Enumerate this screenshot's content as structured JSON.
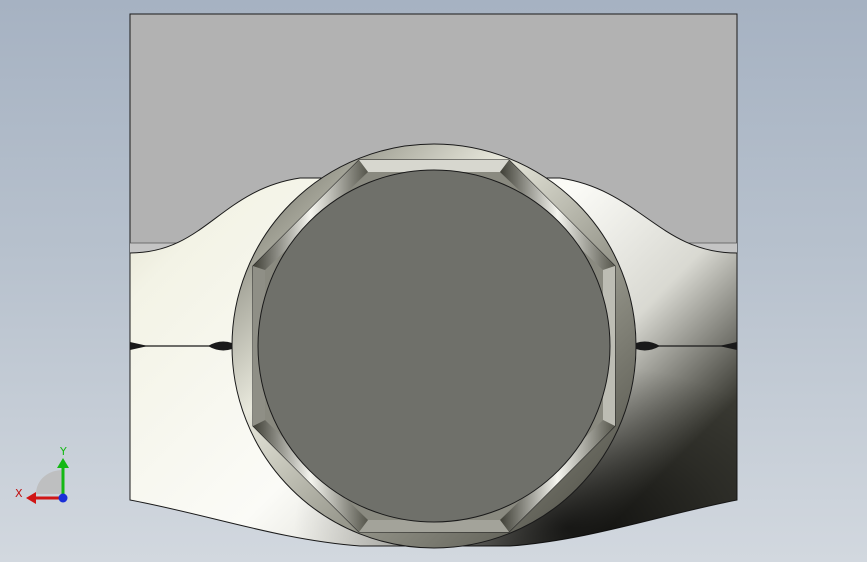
{
  "viewport": {
    "name": "cad-graphics-area"
  },
  "triad": {
    "x_label": "X",
    "y_label": "Y",
    "x_color": "#d01515",
    "y_color": "#14b814",
    "z_color": "#1a2fd8"
  },
  "model": {
    "body_color": "#b2b2b2",
    "face_color": "#6f706a",
    "accent_light": "#f6f6ee",
    "accent_shadow": "#1f1f1a"
  }
}
